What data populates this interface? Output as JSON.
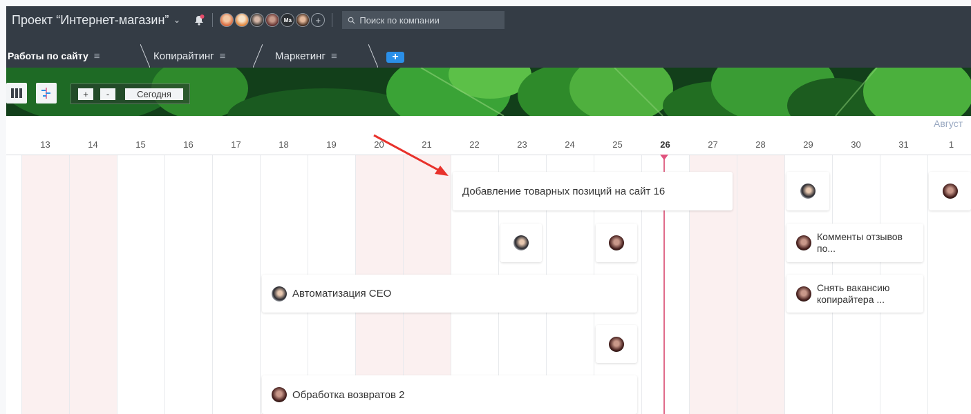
{
  "header": {
    "project_title": "Проект “Интернет-магазин”",
    "avatar_initials": "Ма",
    "search_placeholder": "Поиск по компании"
  },
  "tabs": [
    {
      "label": "Работы по сайту",
      "active": true
    },
    {
      "label": "Копирайтинг",
      "active": false
    },
    {
      "label": "Маркетинг",
      "active": false
    }
  ],
  "toolbar": {
    "zoom_in": "+",
    "zoom_out": "-",
    "today_label": "Сегодня"
  },
  "calendar": {
    "month_label": "Август",
    "days": [
      "13",
      "14",
      "15",
      "16",
      "17",
      "18",
      "19",
      "20",
      "21",
      "22",
      "23",
      "24",
      "25",
      "26",
      "27",
      "28",
      "29",
      "30",
      "31",
      "1"
    ],
    "today": "26"
  },
  "tasks": [
    {
      "title": "Добавление товарных позиций на сайт 16"
    },
    {
      "title": "Автоматизация СЕО"
    },
    {
      "title": "Обработка возвратов 2"
    },
    {
      "title": "Комменты отзывов по..."
    },
    {
      "title": "Снять вакансию копирайтера ..."
    }
  ],
  "colors": {
    "header_bg": "#343c45",
    "today_line": "#e06b8a",
    "weekend_bg": "#fbf0f0",
    "add_tab": "#2a8fe8",
    "annotation_arrow": "#e8322c"
  }
}
